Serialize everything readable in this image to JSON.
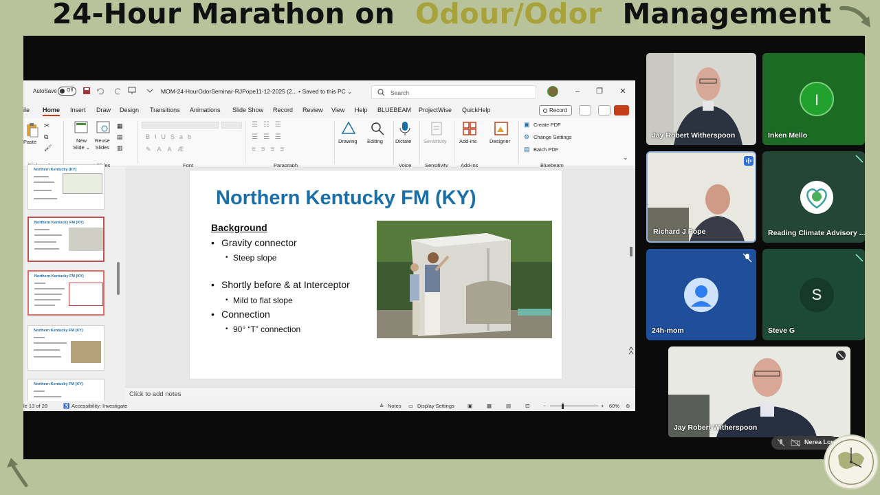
{
  "banner": {
    "title_part1": "24-Hour Marathon on",
    "title_highlight": "Odour/Odor",
    "title_part2": "Management",
    "highlight_color": "#a8a23a"
  },
  "ppt": {
    "autosave_label": "AutoSave",
    "autosave_state": "Off",
    "document_title": "MOM-24-HourOdorSeminar-RJPope11-12-2025 (2... • Saved to this PC ⌄",
    "search_placeholder": "Search",
    "tabs": [
      "ile",
      "Home",
      "Insert",
      "Draw",
      "Design",
      "Transitions",
      "Animations",
      "Slide Show",
      "Record",
      "Review",
      "View",
      "Help",
      "BLUEBEAM",
      "ProjectWise",
      "QuickHelp"
    ],
    "active_tab": "Home",
    "record_button": "Record",
    "ribbon": {
      "paste": "Paste",
      "new_slide": "New\nSlide ⌄",
      "reuse_slides": "Reuse\nSlides",
      "drawing": "Drawing",
      "editing": "Editing",
      "dictate": "Dictate",
      "sensitivity": "Sensitivity",
      "addins": "Add-ins",
      "designer": "Designer",
      "create_pdf": "Create PDF",
      "change_settings": "Change Settings",
      "batch_pdf": "Batch PDF",
      "groups": [
        "Clipboard",
        "Slides",
        "Font",
        "Paragraph",
        "Voice",
        "Sensitivity",
        "Add-ins",
        "Bluebeam"
      ]
    },
    "thumbnails": [
      {
        "title": "Northern Kentucky (KY)"
      },
      {
        "title": "Northern Kentucky FM (KY)"
      },
      {
        "title": "Northern Kentucky FM (KY)"
      },
      {
        "title": "Northern Kentucky FM (KY)"
      },
      {
        "title": "Northern Kentucky FM (KY)"
      }
    ],
    "slide": {
      "title": "Northern Kentucky FM (KY)",
      "section": "Background",
      "bullets": [
        {
          "text": "Gravity connector",
          "sub": "Steep slope"
        },
        {
          "text": "Shortly before & at Interceptor",
          "sub": "Mild to flat slope"
        },
        {
          "text": "Connection",
          "sub": "90° “T” connection"
        }
      ]
    },
    "notes_placeholder": "Click to add notes",
    "status": {
      "slide_counter": "le 13 of 28",
      "accessibility": "Accessibility: Investigate",
      "notes": "Notes",
      "display_settings": "Display Settings",
      "zoom": "60%"
    }
  },
  "participants": [
    {
      "name": "Jay Robert Witherspoon",
      "kind": "video"
    },
    {
      "name": "Inken Mello",
      "initial": "I",
      "color": "#1f8a2a"
    },
    {
      "name": "Richard J Pope",
      "kind": "video"
    },
    {
      "name": "Reading Climate Advisory ...",
      "kind": "logo"
    },
    {
      "name": "24h-mom",
      "kind": "avatar"
    },
    {
      "name": "Steve G",
      "initial": "S",
      "color": "#2a4d3c"
    },
    {
      "name": "Jay Robert Witherspoon",
      "kind": "video"
    }
  ],
  "bottom_bar": {
    "name": "Nerea Lop"
  }
}
